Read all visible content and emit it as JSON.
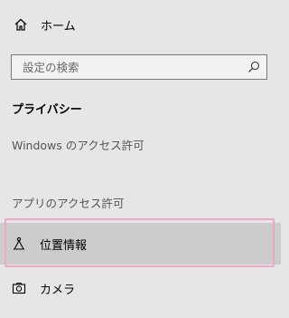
{
  "nav": {
    "home_label": "ホーム",
    "search_placeholder": "設定の検索",
    "section_title": "プライバシー",
    "windows_permission": "Windows のアクセス許可",
    "app_permission": "アプリのアクセス許可",
    "items": [
      {
        "label": "位置情報",
        "icon": "location-icon",
        "selected": true
      },
      {
        "label": "カメラ",
        "icon": "camera-icon",
        "selected": false
      }
    ]
  },
  "colors": {
    "background": "#e6e6e6",
    "selected_background": "#cccccc",
    "highlight_border": "#f0a6c8"
  }
}
